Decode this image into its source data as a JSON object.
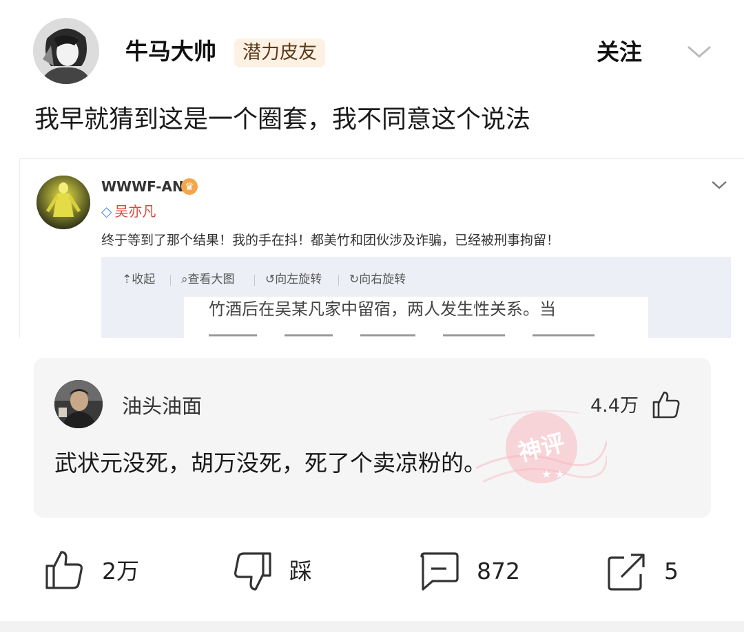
{
  "post": {
    "author": "牛马大帅",
    "badge": "潜力皮友",
    "follow_label": "关注",
    "text": "我早就猜到这是一个圈套，我不同意这个说法"
  },
  "embedded": {
    "username": "WWWF-AN",
    "subtitle": "吴亦凡",
    "text": "终于等到了那个结果！我的手在抖！都美竹和团伙涉及诈骗，已经被刑事拘留！",
    "toolbar": [
      "收起",
      "查看大图",
      "向左旋转",
      "向右旋转"
    ],
    "quote_line1": "竹酒后在吴某凡家中留宿，两人发生性关系。当"
  },
  "comment": {
    "username": "油头油面",
    "like_count": "4.4万",
    "text": "武状元没死，胡万没死，死了个卖凉粉的。",
    "stamp_text": "神评"
  },
  "actions": {
    "like": "2万",
    "dislike": "踩",
    "comment": "872",
    "share": "5"
  }
}
